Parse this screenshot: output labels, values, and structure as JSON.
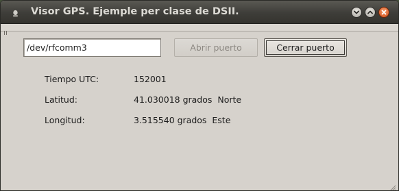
{
  "window": {
    "title": "Visor GPS. Ejemple per clase de DSII.",
    "controls": [
      "minimize-icon",
      "maximize-icon",
      "close-icon"
    ]
  },
  "toolbar": {
    "port_value": "/dev/rfcomm3",
    "open_label": "Abrir puerto",
    "close_label": "Cerrar puerto"
  },
  "info": {
    "utc_label": "Tiempo UTC:",
    "utc_value": "152001",
    "lat_label": "Latitud:",
    "lat_value": "41.030018 grados  Norte",
    "lon_label": "Longitud:",
    "lon_value": "3.515540 grados  Este"
  },
  "colors": {
    "window_bg": "#d6d2cc",
    "titlebar": "#3e3d39",
    "close_button": "#d24f19"
  }
}
